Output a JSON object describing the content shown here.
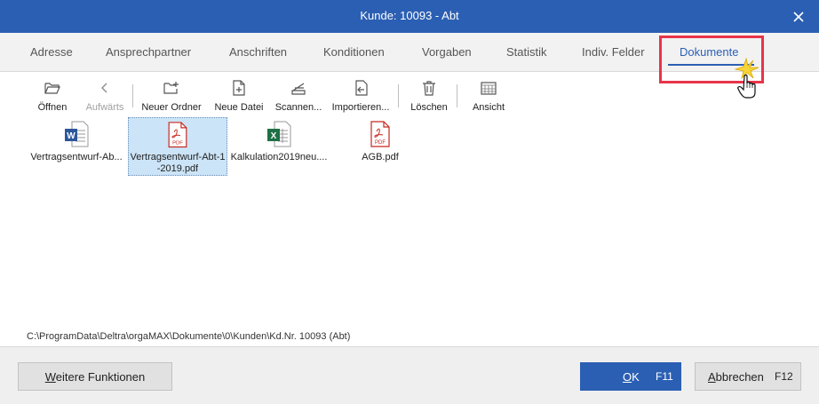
{
  "window": {
    "title": "Kunde: 10093 - Abt",
    "close_label": "Schließen"
  },
  "tabs": [
    {
      "label": "Adresse"
    },
    {
      "label": "Ansprechpartner"
    },
    {
      "label": "Anschriften"
    },
    {
      "label": "Konditionen"
    },
    {
      "label": "Vorgaben"
    },
    {
      "label": "Statistik"
    },
    {
      "label": "Indiv. Felder"
    },
    {
      "label": "Dokumente",
      "active": true
    }
  ],
  "toolbar": [
    {
      "label": "Öffnen",
      "icon": "open-folder-icon"
    },
    {
      "label": "Aufwärts",
      "icon": "chevron-left-icon",
      "disabled": true
    },
    {
      "label": "Neuer Ordner",
      "icon": "new-folder-icon"
    },
    {
      "label": "Neue Datei",
      "icon": "new-file-icon"
    },
    {
      "label": "Scannen...",
      "icon": "scanner-icon"
    },
    {
      "label": "Importieren...",
      "icon": "import-icon"
    },
    {
      "label": "Löschen",
      "icon": "trash-icon"
    },
    {
      "label": "Ansicht",
      "icon": "view-grid-icon"
    }
  ],
  "files": [
    {
      "name": "Vertragsentwurf-Ab...",
      "type": "word"
    },
    {
      "name_line1": "Vertragsentwurf-Abt-1",
      "name_line2": "-2019.pdf",
      "type": "pdf",
      "selected": true
    },
    {
      "name": "Kalkulation2019neu....",
      "type": "excel"
    },
    {
      "name": "AGB.pdf",
      "type": "pdf"
    }
  ],
  "path": "C:\\ProgramData\\Deltra\\orgaMAX\\Dokumente\\0\\Kunden\\Kd.Nr. 10093 (Abt)",
  "footer": {
    "more_mnemonic": "W",
    "more_rest": "eitere Funktionen",
    "ok_mnemonic": "O",
    "ok_rest": "K",
    "ok_key": "F11",
    "cancel_mnemonic": "A",
    "cancel_rest": "bbrechen",
    "cancel_key": "F12"
  },
  "colors": {
    "accent": "#2b5fb3",
    "highlight": "#e8344a",
    "selection": "#cce4f7"
  }
}
